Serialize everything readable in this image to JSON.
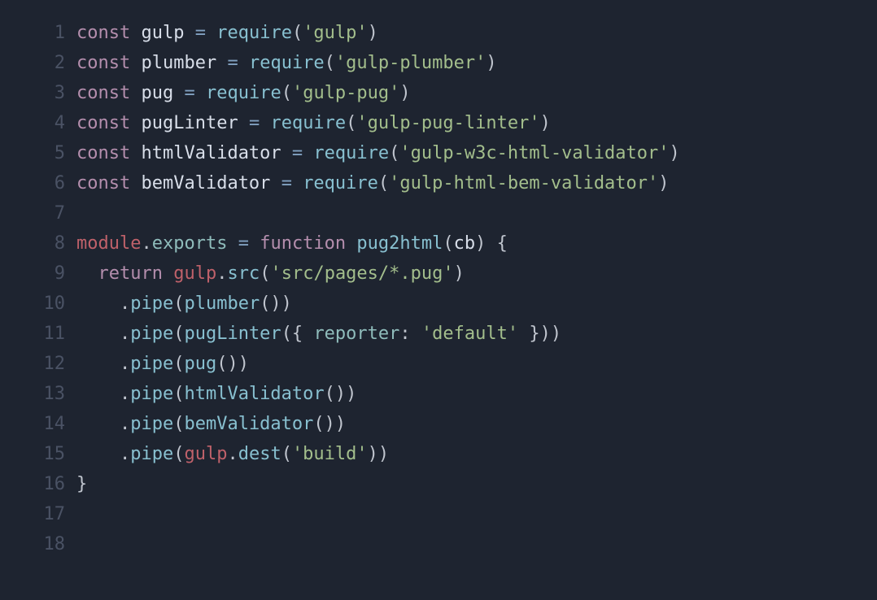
{
  "colors": {
    "background": "#1e2430",
    "gutter": "#4a5264",
    "keyword": "#b48ead",
    "identifier": "#d8dee9",
    "function": "#88c0d0",
    "property": "#8fbcbb",
    "object": "#bf616a",
    "string": "#a3be8c",
    "punct": "#c0c5ce",
    "operator": "#81a1c1"
  },
  "lines": [
    {
      "n": "1",
      "tokens": [
        {
          "c": "kw",
          "t": "const"
        },
        {
          "c": "pun",
          "t": " "
        },
        {
          "c": "var",
          "t": "gulp"
        },
        {
          "c": "pun",
          "t": " "
        },
        {
          "c": "op",
          "t": "="
        },
        {
          "c": "pun",
          "t": " "
        },
        {
          "c": "fn",
          "t": "require"
        },
        {
          "c": "pun",
          "t": "("
        },
        {
          "c": "str",
          "t": "'gulp'"
        },
        {
          "c": "pun",
          "t": ")"
        }
      ]
    },
    {
      "n": "2",
      "tokens": [
        {
          "c": "kw",
          "t": "const"
        },
        {
          "c": "pun",
          "t": " "
        },
        {
          "c": "var",
          "t": "plumber"
        },
        {
          "c": "pun",
          "t": " "
        },
        {
          "c": "op",
          "t": "="
        },
        {
          "c": "pun",
          "t": " "
        },
        {
          "c": "fn",
          "t": "require"
        },
        {
          "c": "pun",
          "t": "("
        },
        {
          "c": "str",
          "t": "'gulp-plumber'"
        },
        {
          "c": "pun",
          "t": ")"
        }
      ]
    },
    {
      "n": "3",
      "tokens": [
        {
          "c": "kw",
          "t": "const"
        },
        {
          "c": "pun",
          "t": " "
        },
        {
          "c": "var",
          "t": "pug"
        },
        {
          "c": "pun",
          "t": " "
        },
        {
          "c": "op",
          "t": "="
        },
        {
          "c": "pun",
          "t": " "
        },
        {
          "c": "fn",
          "t": "require"
        },
        {
          "c": "pun",
          "t": "("
        },
        {
          "c": "str",
          "t": "'gulp-pug'"
        },
        {
          "c": "pun",
          "t": ")"
        }
      ]
    },
    {
      "n": "4",
      "tokens": [
        {
          "c": "kw",
          "t": "const"
        },
        {
          "c": "pun",
          "t": " "
        },
        {
          "c": "var",
          "t": "pugLinter"
        },
        {
          "c": "pun",
          "t": " "
        },
        {
          "c": "op",
          "t": "="
        },
        {
          "c": "pun",
          "t": " "
        },
        {
          "c": "fn",
          "t": "require"
        },
        {
          "c": "pun",
          "t": "("
        },
        {
          "c": "str",
          "t": "'gulp-pug-linter'"
        },
        {
          "c": "pun",
          "t": ")"
        }
      ]
    },
    {
      "n": "5",
      "tokens": [
        {
          "c": "kw",
          "t": "const"
        },
        {
          "c": "pun",
          "t": " "
        },
        {
          "c": "var",
          "t": "htmlValidator"
        },
        {
          "c": "pun",
          "t": " "
        },
        {
          "c": "op",
          "t": "="
        },
        {
          "c": "pun",
          "t": " "
        },
        {
          "c": "fn",
          "t": "require"
        },
        {
          "c": "pun",
          "t": "("
        },
        {
          "c": "str",
          "t": "'gulp-w3c-html-validator'"
        },
        {
          "c": "pun",
          "t": ")"
        }
      ]
    },
    {
      "n": "6",
      "tokens": [
        {
          "c": "kw",
          "t": "const"
        },
        {
          "c": "pun",
          "t": " "
        },
        {
          "c": "var",
          "t": "bemValidator"
        },
        {
          "c": "pun",
          "t": " "
        },
        {
          "c": "op",
          "t": "="
        },
        {
          "c": "pun",
          "t": " "
        },
        {
          "c": "fn",
          "t": "require"
        },
        {
          "c": "pun",
          "t": "("
        },
        {
          "c": "str",
          "t": "'gulp-html-bem-validator'"
        },
        {
          "c": "pun",
          "t": ")"
        }
      ]
    },
    {
      "n": "7",
      "tokens": []
    },
    {
      "n": "8",
      "tokens": [
        {
          "c": "obj",
          "t": "module"
        },
        {
          "c": "pun",
          "t": "."
        },
        {
          "c": "prop",
          "t": "exports"
        },
        {
          "c": "pun",
          "t": " "
        },
        {
          "c": "op",
          "t": "="
        },
        {
          "c": "pun",
          "t": " "
        },
        {
          "c": "kw",
          "t": "function"
        },
        {
          "c": "pun",
          "t": " "
        },
        {
          "c": "fn",
          "t": "pug2html"
        },
        {
          "c": "pun",
          "t": "("
        },
        {
          "c": "var",
          "t": "cb"
        },
        {
          "c": "pun",
          "t": ") {"
        }
      ]
    },
    {
      "n": "9",
      "tokens": [
        {
          "c": "pun",
          "t": "  "
        },
        {
          "c": "kw",
          "t": "return"
        },
        {
          "c": "pun",
          "t": " "
        },
        {
          "c": "obj",
          "t": "gulp"
        },
        {
          "c": "pun",
          "t": "."
        },
        {
          "c": "fn",
          "t": "src"
        },
        {
          "c": "pun",
          "t": "("
        },
        {
          "c": "str",
          "t": "'src/pages/*.pug'"
        },
        {
          "c": "pun",
          "t": ")"
        }
      ]
    },
    {
      "n": "10",
      "tokens": [
        {
          "c": "pun",
          "t": "    ."
        },
        {
          "c": "fn",
          "t": "pipe"
        },
        {
          "c": "pun",
          "t": "("
        },
        {
          "c": "fn",
          "t": "plumber"
        },
        {
          "c": "pun",
          "t": "())"
        }
      ]
    },
    {
      "n": "11",
      "tokens": [
        {
          "c": "pun",
          "t": "    ."
        },
        {
          "c": "fn",
          "t": "pipe"
        },
        {
          "c": "pun",
          "t": "("
        },
        {
          "c": "fn",
          "t": "pugLinter"
        },
        {
          "c": "pun",
          "t": "({ "
        },
        {
          "c": "prop",
          "t": "reporter"
        },
        {
          "c": "pun",
          "t": ": "
        },
        {
          "c": "str",
          "t": "'default'"
        },
        {
          "c": "pun",
          "t": " }))"
        }
      ]
    },
    {
      "n": "12",
      "tokens": [
        {
          "c": "pun",
          "t": "    ."
        },
        {
          "c": "fn",
          "t": "pipe"
        },
        {
          "c": "pun",
          "t": "("
        },
        {
          "c": "fn",
          "t": "pug"
        },
        {
          "c": "pun",
          "t": "())"
        }
      ]
    },
    {
      "n": "13",
      "tokens": [
        {
          "c": "pun",
          "t": "    ."
        },
        {
          "c": "fn",
          "t": "pipe"
        },
        {
          "c": "pun",
          "t": "("
        },
        {
          "c": "fn",
          "t": "htmlValidator"
        },
        {
          "c": "pun",
          "t": "())"
        }
      ]
    },
    {
      "n": "14",
      "tokens": [
        {
          "c": "pun",
          "t": "    ."
        },
        {
          "c": "fn",
          "t": "pipe"
        },
        {
          "c": "pun",
          "t": "("
        },
        {
          "c": "fn",
          "t": "bemValidator"
        },
        {
          "c": "pun",
          "t": "())"
        }
      ]
    },
    {
      "n": "15",
      "tokens": [
        {
          "c": "pun",
          "t": "    ."
        },
        {
          "c": "fn",
          "t": "pipe"
        },
        {
          "c": "pun",
          "t": "("
        },
        {
          "c": "obj",
          "t": "gulp"
        },
        {
          "c": "pun",
          "t": "."
        },
        {
          "c": "fn",
          "t": "dest"
        },
        {
          "c": "pun",
          "t": "("
        },
        {
          "c": "str",
          "t": "'build'"
        },
        {
          "c": "pun",
          "t": "))"
        }
      ]
    },
    {
      "n": "16",
      "tokens": [
        {
          "c": "pun",
          "t": "}"
        }
      ]
    },
    {
      "n": "17",
      "tokens": []
    },
    {
      "n": "18",
      "tokens": []
    }
  ]
}
